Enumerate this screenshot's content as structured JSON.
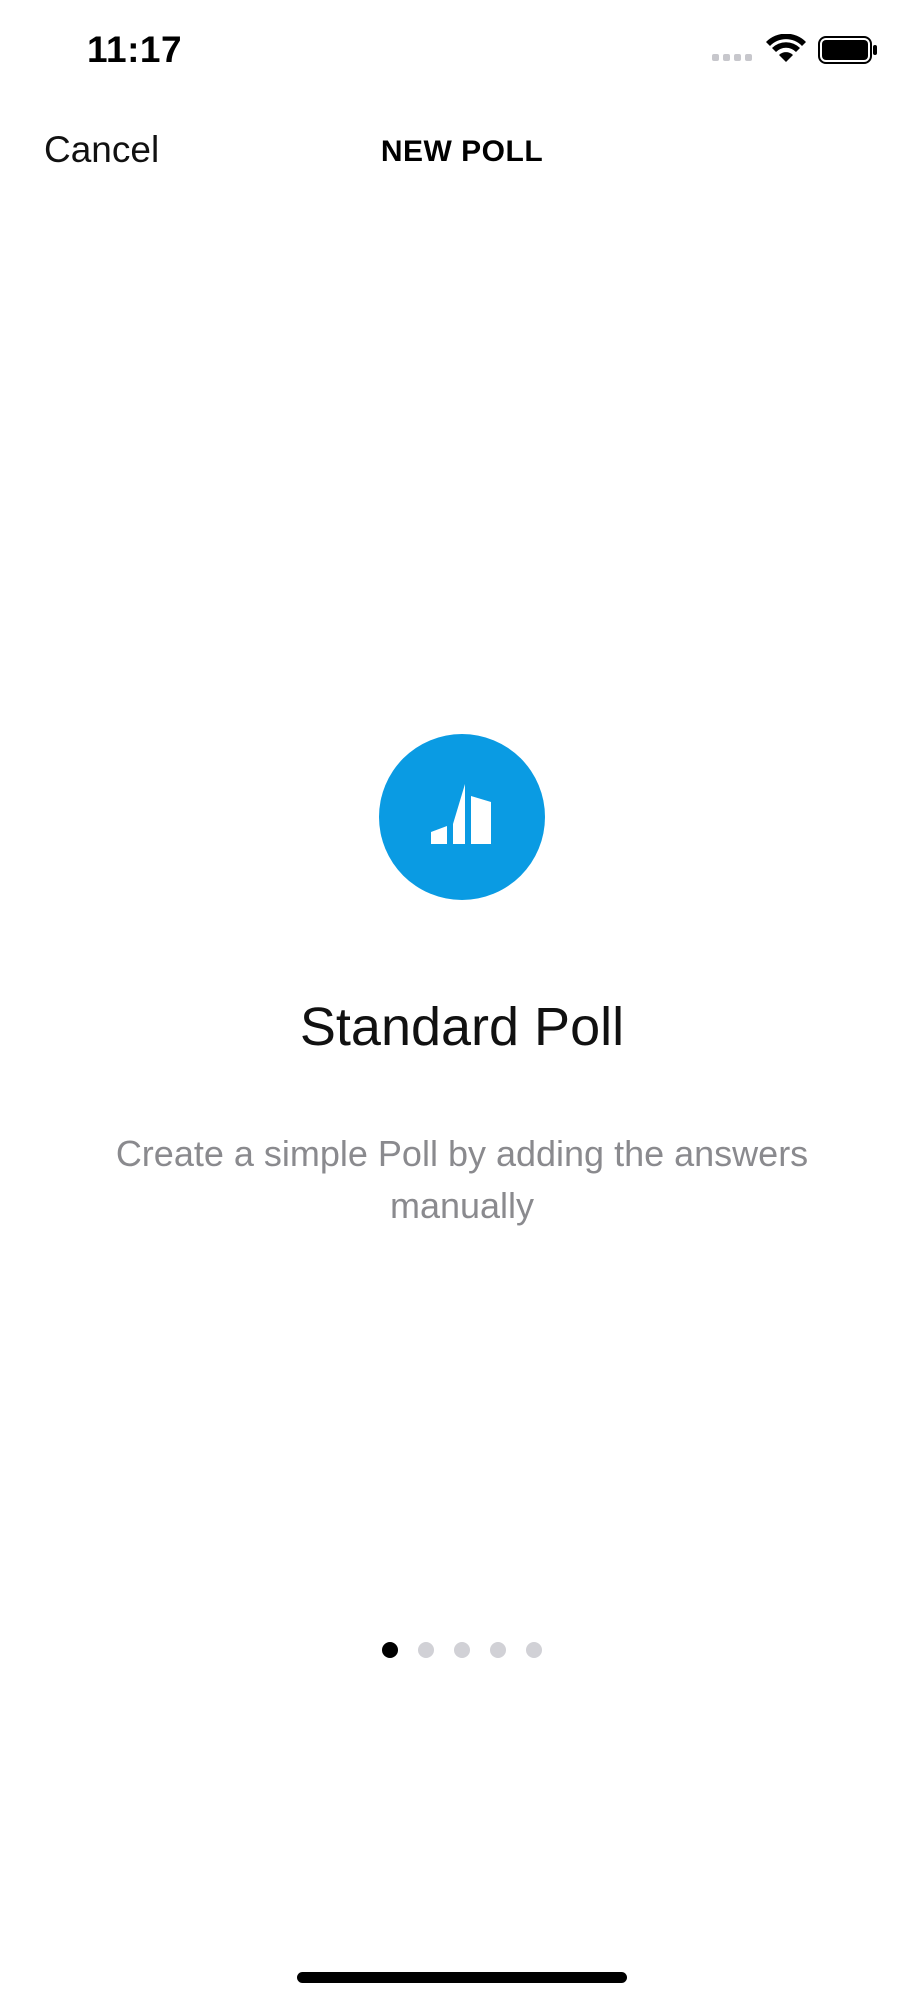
{
  "status_bar": {
    "time": "11:17",
    "icons": [
      "signal-icon",
      "wifi-icon",
      "battery-icon"
    ]
  },
  "nav": {
    "cancel_label": "Cancel",
    "title": "NEW POLL"
  },
  "card": {
    "icon": "bar-chart-icon",
    "icon_color": "#0a9be3",
    "title": "Standard Poll",
    "description": "Create a simple Poll by adding the answers manually"
  },
  "pager": {
    "total": 5,
    "active_index": 0
  }
}
